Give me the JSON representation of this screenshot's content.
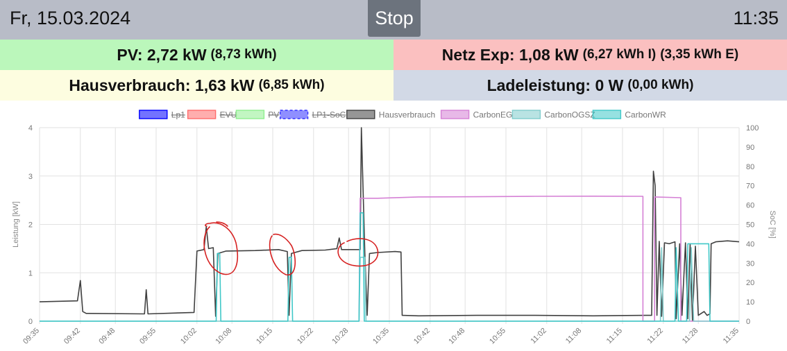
{
  "header": {
    "date": "Fr, 15.03.2024",
    "stop_label": "Stop",
    "time": "11:35"
  },
  "tiles": {
    "pv": {
      "label": "PV: 2,72 kW",
      "energy": "(8,73 kWh)"
    },
    "grid": {
      "label": "Netz Exp: 1,08 kW",
      "import": "(6,27 kWh I)",
      "export": "(3,35 kWh E)"
    },
    "house": {
      "label": "Hausverbrauch: 1,63 kW",
      "energy": "(6,85 kWh)"
    },
    "charge": {
      "label": "Ladeleistung: 0 W",
      "energy": "(0,00 kWh)"
    }
  },
  "colors": {
    "lp1": "#0000ff",
    "evu": "#ff6b6b",
    "pv": "#90ee90",
    "soc": "#3333ff",
    "house": "#404040",
    "carbon_eg": "#d580d5",
    "carbon_ogsz": "#80cccc",
    "carbon_wr": "#40c8c8",
    "annotation": "#d62020",
    "grid_line": "#e2e2e2"
  },
  "chart_data": {
    "type": "line",
    "ylabel": "Leistung [kW]",
    "y2label": "SoC [%]",
    "ylim": [
      0,
      4
    ],
    "y2lim": [
      0,
      100
    ],
    "yticks": [
      "0",
      "1",
      "2",
      "3",
      "4"
    ],
    "y2ticks": [
      "0",
      "10",
      "20",
      "30",
      "40",
      "50",
      "60",
      "70",
      "80",
      "90",
      "100"
    ],
    "xlim": [
      575,
      695
    ],
    "x_ticks": [
      {
        "t": 575,
        "label": "09:35"
      },
      {
        "t": 582,
        "label": "09:42"
      },
      {
        "t": 588,
        "label": "09:48"
      },
      {
        "t": 595,
        "label": "09:55"
      },
      {
        "t": 602,
        "label": "10:02"
      },
      {
        "t": 608,
        "label": "10:08"
      },
      {
        "t": 615,
        "label": "10:15"
      },
      {
        "t": 622,
        "label": "10:22"
      },
      {
        "t": 628,
        "label": "10:28"
      },
      {
        "t": 635,
        "label": "10:35"
      },
      {
        "t": 642,
        "label": "10:42"
      },
      {
        "t": 648,
        "label": "10:48"
      },
      {
        "t": 655,
        "label": "10:55"
      },
      {
        "t": 662,
        "label": "11:02"
      },
      {
        "t": 668,
        "label": "11:08"
      },
      {
        "t": 675,
        "label": "11:15"
      },
      {
        "t": 682,
        "label": "11:22"
      },
      {
        "t": 688,
        "label": "11:28"
      },
      {
        "t": 695,
        "label": "11:35"
      }
    ],
    "legend_position": "top",
    "grid": true,
    "series": [
      {
        "name": "Lp1",
        "color": "#0000ff",
        "hidden": true,
        "axis": "kw",
        "points": []
      },
      {
        "name": "EVU",
        "color": "#ff6b6b",
        "hidden": true,
        "axis": "kw",
        "points": []
      },
      {
        "name": "PV",
        "color": "#90ee90",
        "hidden": true,
        "axis": "kw",
        "points": []
      },
      {
        "name": "LP1-SoC",
        "color": "#3333ff",
        "hidden": true,
        "dashed": true,
        "axis": "soc",
        "points": []
      },
      {
        "name": "Hausverbrauch",
        "color": "#404040",
        "hidden": false,
        "axis": "kw",
        "points": [
          [
            575,
            0.4
          ],
          [
            581.5,
            0.42
          ],
          [
            582,
            0.84
          ],
          [
            582.4,
            0.2
          ],
          [
            583,
            0.16
          ],
          [
            593,
            0.15
          ],
          [
            593.3,
            0.65
          ],
          [
            593.6,
            0.15
          ],
          [
            601.5,
            0.18
          ],
          [
            602,
            1.45
          ],
          [
            603.2,
            1.48
          ],
          [
            603.6,
            1.95
          ],
          [
            604,
            1.5
          ],
          [
            604.8,
            1.52
          ],
          [
            605.2,
            0.1
          ],
          [
            605.6,
            1.4
          ],
          [
            607,
            1.45
          ],
          [
            612,
            1.46
          ],
          [
            616,
            1.48
          ],
          [
            617.5,
            1.44
          ],
          [
            617.8,
            0.12
          ],
          [
            618.2,
            1.4
          ],
          [
            620,
            1.46
          ],
          [
            624,
            1.47
          ],
          [
            626,
            1.5
          ],
          [
            626.4,
            1.72
          ],
          [
            626.8,
            1.48
          ],
          [
            630,
            1.48
          ],
          [
            630.2,
            4.0
          ],
          [
            630.5,
            2.7
          ],
          [
            630.8,
            1.4
          ],
          [
            631.2,
            0.12
          ],
          [
            631.6,
            1.4
          ],
          [
            633,
            1.42
          ],
          [
            636,
            1.44
          ],
          [
            637,
            1.43
          ],
          [
            637.2,
            0.12
          ],
          [
            640,
            0.11
          ],
          [
            650,
            0.12
          ],
          [
            660,
            0.12
          ],
          [
            670,
            0.11
          ],
          [
            679,
            0.12
          ],
          [
            680,
            0.12
          ],
          [
            680.3,
            3.1
          ],
          [
            680.6,
            2.8
          ],
          [
            680.9,
            0.12
          ],
          [
            681.3,
            1.65
          ],
          [
            681.7,
            0.1
          ],
          [
            682.2,
            1.62
          ],
          [
            683,
            1.6
          ],
          [
            684,
            1.64
          ],
          [
            684.2,
            0.05
          ],
          [
            684.8,
            1.6
          ],
          [
            685.2,
            0.12
          ],
          [
            685.8,
            1.62
          ],
          [
            686.2,
            0.05
          ],
          [
            686.6,
            1.6
          ],
          [
            687,
            0.0
          ],
          [
            687.5,
            1.55
          ],
          [
            688,
            0.12
          ],
          [
            689,
            0.2
          ],
          [
            689.5,
            0.12
          ],
          [
            690,
            0.15
          ],
          [
            690.2,
            1.6
          ],
          [
            691,
            1.64
          ],
          [
            693,
            1.66
          ],
          [
            695,
            1.64
          ]
        ]
      },
      {
        "name": "CarbonEG",
        "color": "#d580d5",
        "hidden": false,
        "axis": "soc",
        "points": [
          [
            629.8,
            0
          ],
          [
            630,
            63.5
          ],
          [
            633,
            63.5
          ],
          [
            640,
            64.2
          ],
          [
            650,
            64.3
          ],
          [
            660,
            64.5
          ],
          [
            670,
            64.6
          ],
          [
            678.5,
            64.5
          ],
          [
            678.5,
            0
          ],
          [
            680.5,
            0
          ],
          [
            680.5,
            64.2
          ],
          [
            685,
            63.8
          ],
          [
            685,
            0
          ],
          [
            695,
            0
          ]
        ]
      },
      {
        "name": "CarbonOGSZ",
        "color": "#80cccc",
        "hidden": false,
        "axis": "soc",
        "points": [
          [
            575,
            0
          ],
          [
            629.8,
            0
          ],
          [
            630,
            33
          ],
          [
            630.8,
            33
          ],
          [
            631,
            0
          ],
          [
            681.5,
            0
          ],
          [
            681.7,
            38
          ],
          [
            682,
            0
          ],
          [
            686.5,
            0
          ],
          [
            686.8,
            38
          ],
          [
            687.2,
            0
          ],
          [
            695,
            0
          ]
        ]
      },
      {
        "name": "CarbonWR",
        "color": "#40c8c8",
        "hidden": false,
        "axis": "soc",
        "points": [
          [
            575,
            0
          ],
          [
            605.3,
            0
          ],
          [
            605.5,
            35
          ],
          [
            605.9,
            35
          ],
          [
            606.1,
            0
          ],
          [
            617.6,
            0
          ],
          [
            617.8,
            33
          ],
          [
            618.2,
            33
          ],
          [
            618.4,
            0
          ],
          [
            629.8,
            0
          ],
          [
            630,
            56
          ],
          [
            630.5,
            56
          ],
          [
            630.7,
            0
          ],
          [
            684,
            0
          ],
          [
            684.2,
            38
          ],
          [
            684.6,
            0
          ],
          [
            686,
            0
          ],
          [
            686.2,
            40
          ],
          [
            689.8,
            40
          ],
          [
            690,
            0
          ],
          [
            695,
            0
          ]
        ]
      }
    ]
  }
}
